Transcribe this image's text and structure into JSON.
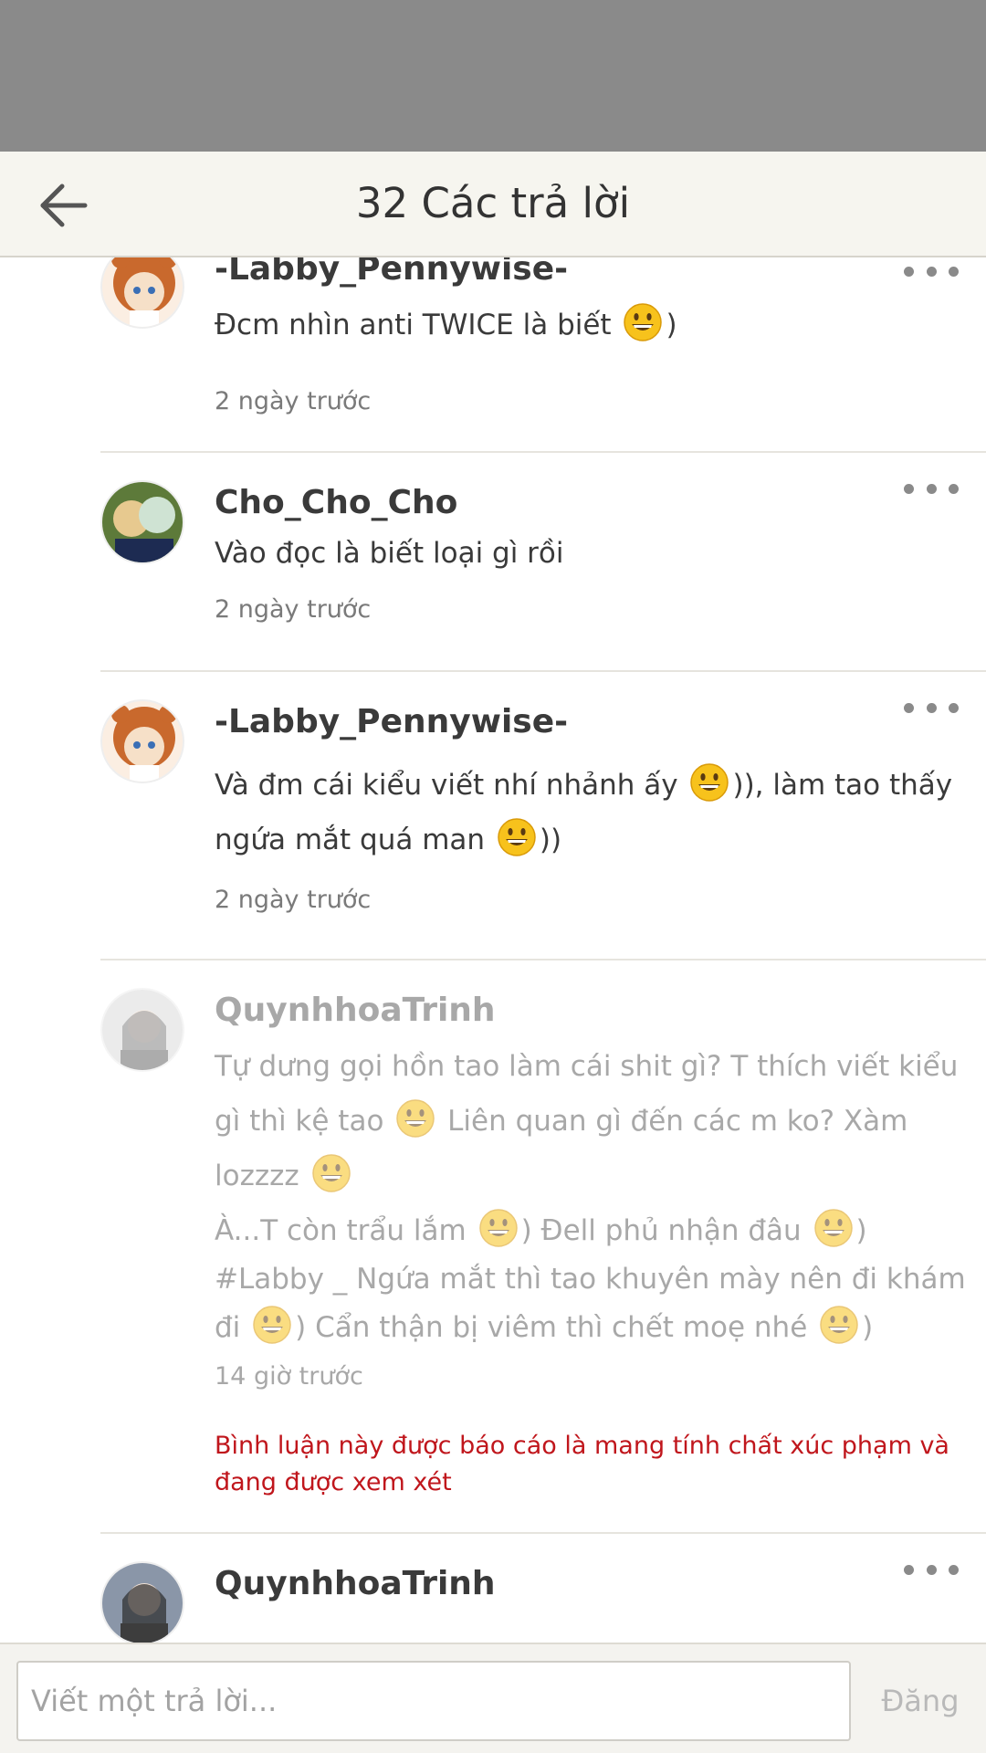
{
  "header": {
    "title": "32 Các trả lời"
  },
  "replies": [
    {
      "username": "-Labby_Pennywise-",
      "lines": [
        {
          "segments": [
            "Đcm nhìn anti TWICE là biết ",
            ":grinning:",
            ")"
          ]
        }
      ],
      "time": "2 ngày trước"
    },
    {
      "username": "Cho_Cho_Cho",
      "lines": [
        {
          "segments": [
            "Vào đọc là biết loại gì rồi"
          ]
        }
      ],
      "time": "2 ngày trước"
    },
    {
      "username": "-Labby_Pennywise-",
      "lines": [
        {
          "segments": [
            "Và đm cái kiểu viết nhí nhảnh ấy ",
            ":grinning:",
            ")), làm tao thấy"
          ]
        },
        {
          "segments": [
            "ngứa mắt quá man ",
            ":grinning:",
            "))"
          ]
        }
      ],
      "time": "2 ngày trước"
    },
    {
      "username": "QuynhhoaTrinh",
      "lines": [
        {
          "segments": [
            "Tự dưng gọi hồn tao làm cái shit gì? T thích viết kiểu"
          ]
        },
        {
          "segments": [
            "gì thì kệ tao ",
            ":grinning:",
            " Liên quan gì đến các m ko? Xàm"
          ]
        },
        {
          "segments": [
            "lozzzz ",
            ":grinning:"
          ]
        },
        {
          "segments": [
            "À...T còn trẩu lắm ",
            ":grinning:",
            ") Đell phủ nhận đâu ",
            ":grinning:",
            ")"
          ]
        },
        {
          "segments": [
            "#Labby _ Ngứa mắt thì tao khuyên mày nên đi khám"
          ]
        },
        {
          "segments": [
            "đi ",
            ":grinning:",
            ") Cẩn thận bị viêm thì chết moẹ nhé ",
            ":grinning:",
            ")"
          ]
        }
      ],
      "time": "14 giờ trước",
      "report_note": "Bình luận này được báo cáo là mang tính chất xúc phạm và đang được xem xét"
    },
    {
      "username": "QuynhhoaTrinh",
      "lines": [],
      "time": ""
    }
  ],
  "compose": {
    "placeholder": "Viết một trả lời...",
    "post_label": "Đăng"
  },
  "colors": {
    "status_area": "#8a8a8a",
    "header_bg": "#f6f5ef",
    "report_red": "#c0161c",
    "text": "#3a3a3a",
    "muted": "#7a7a7a"
  },
  "icons": {
    "back": "arrow-left-icon",
    "more": "more-horizontal-icon",
    "emoji": "grinning-face-emoji"
  }
}
